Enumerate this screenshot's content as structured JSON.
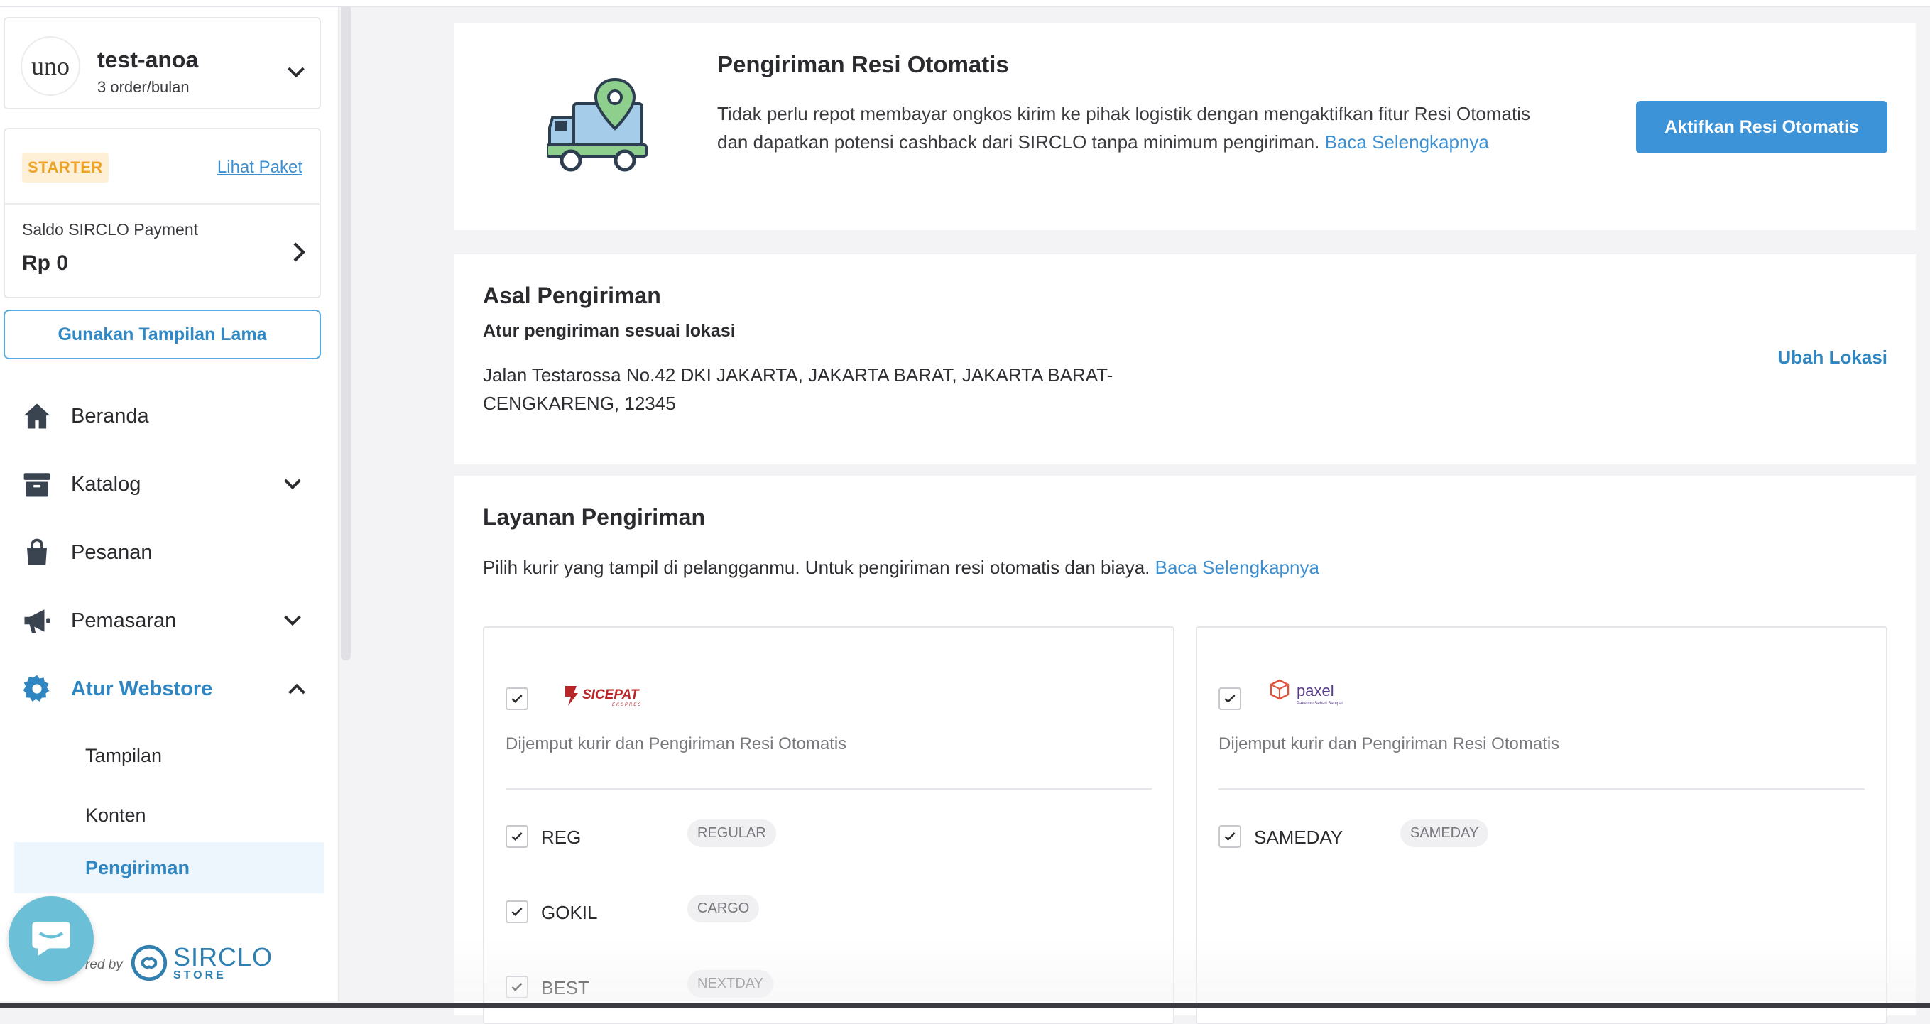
{
  "store": {
    "logo_text": "uno",
    "name": "test-anoa",
    "subtitle": "3 order/bulan"
  },
  "plan": {
    "badge": "STARTER",
    "link": "Lihat Paket",
    "saldo_label": "Saldo SIRCLO Payment",
    "saldo_value": "Rp 0"
  },
  "old_view_button": "Gunakan Tampilan Lama",
  "nav": {
    "items": [
      {
        "label": "Beranda",
        "icon": "home-icon"
      },
      {
        "label": "Katalog",
        "icon": "archive-icon"
      },
      {
        "label": "Pesanan",
        "icon": "bag-icon"
      },
      {
        "label": "Pemasaran",
        "icon": "megaphone-icon"
      },
      {
        "label": "Atur Webstore",
        "icon": "gear-icon"
      }
    ],
    "sub_items": [
      {
        "label": "Tampilan"
      },
      {
        "label": "Konten"
      },
      {
        "label": "Pengiriman"
      }
    ]
  },
  "footer": {
    "powered": "red by",
    "brand": "SIRCLO",
    "brand_sub": "STORE"
  },
  "resi": {
    "title": "Pengiriman Resi Otomatis",
    "desc": "Tidak perlu repot membayar ongkos kirim ke pihak logistik dengan mengaktifkan fitur Resi Otomatis dan dapatkan potensi cashback dari SIRCLO tanpa minimum pengiriman.",
    "link": "Baca Selengkapnya",
    "button": "Aktifkan Resi Otomatis"
  },
  "asal": {
    "title": "Asal Pengiriman",
    "subtitle": "Atur pengiriman sesuai lokasi",
    "address": "Jalan Testarossa No.42 DKI JAKARTA, JAKARTA BARAT, JAKARTA BARAT-CENGKARENG, 12345",
    "action": "Ubah Lokasi"
  },
  "layanan": {
    "title": "Layanan Pengiriman",
    "desc": "Pilih kurir yang tampil di pelangganmu. Untuk pengiriman resi otomatis dan biaya.",
    "link": "Baca Selengkapnya",
    "couriers": [
      {
        "name": "SICEPAT",
        "name_sub": "EKSPRES",
        "desc": "Dijemput kurir dan Pengiriman Resi Otomatis",
        "services": [
          {
            "name": "REG",
            "tag": "REGULAR"
          },
          {
            "name": "GOKIL",
            "tag": "CARGO"
          },
          {
            "name": "BEST",
            "tag": "NEXTDAY"
          }
        ]
      },
      {
        "name": "paxel",
        "name_sub": "Paketmu Sehari Sampai",
        "desc": "Dijemput kurir dan Pengiriman Resi Otomatis",
        "services": [
          {
            "name": "SAMEDAY",
            "tag": "SAMEDAY"
          }
        ]
      }
    ]
  },
  "colors": {
    "accent": "#3d93d7",
    "link": "#3d8fcf",
    "starter_bg": "#fdf0d6",
    "starter_fg": "#f0a227"
  }
}
